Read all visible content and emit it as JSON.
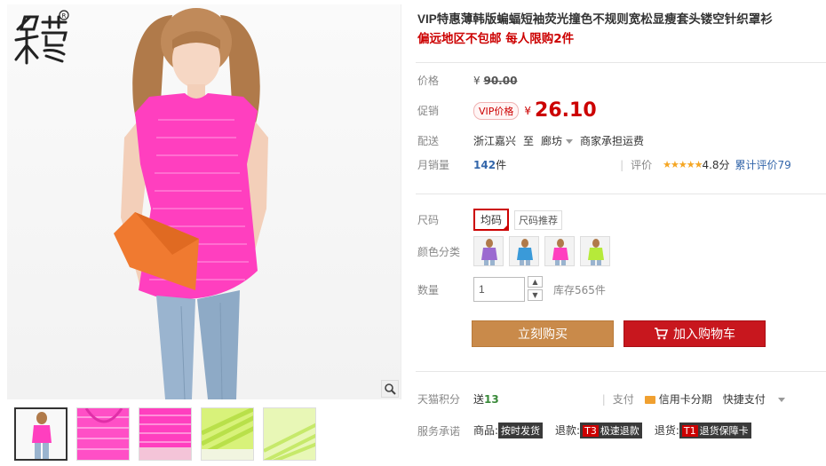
{
  "gallery": {
    "logo_text": "木莹",
    "thumbnails": [
      {
        "name": "thumb-model"
      },
      {
        "name": "thumb-pink-1"
      },
      {
        "name": "thumb-pink-2"
      },
      {
        "name": "thumb-green-1"
      },
      {
        "name": "thumb-green-2"
      }
    ]
  },
  "product": {
    "title": "VIP特惠薄韩版蝙蝠短袖荧光撞色不规则宽松显瘦套头镂空针织罩衫",
    "subtitle": "偏远地区不包邮 每人限购2件"
  },
  "price": {
    "label": "价格",
    "currency": "¥",
    "value": "90.00"
  },
  "promo": {
    "label": "促销",
    "tag": "VIP价格",
    "currency": "¥",
    "value": "26.10"
  },
  "shipping": {
    "label": "配送",
    "from": "浙江嘉兴",
    "to_word": "至",
    "to": "廊坊",
    "fee": "商家承担运费"
  },
  "sales": {
    "label": "月销量",
    "count": "142",
    "unit": "件",
    "rating_label": "评价",
    "stars": "★★★★★",
    "score": "4.8分",
    "review_link": "累计评价79"
  },
  "size": {
    "label": "尺码",
    "option": "均码",
    "recommend": "尺码推荐"
  },
  "colors": {
    "label": "颜色分类",
    "swatches": [
      "purple",
      "blue",
      "pink",
      "green"
    ]
  },
  "quantity": {
    "label": "数量",
    "value": "1",
    "stock": "库存565件"
  },
  "buttons": {
    "buy": "立刻购买",
    "cart": "加入购物车"
  },
  "points": {
    "label": "天猫积分",
    "value_prefix": "送",
    "value": "13",
    "pay_label": "支付",
    "card": "信用卡分期",
    "quick": "快捷支付"
  },
  "service": {
    "label": "服务承诺",
    "item1_prefix": "商品:",
    "item1_tag": "按时发货",
    "item2_prefix": "退款:",
    "item2_code": "T3",
    "item2_tag": "极速退款",
    "item3_prefix": "退货:",
    "item3_code": "T1",
    "item3_tag": "退货保障卡"
  },
  "colors_theme": {
    "price_red": "#cc0000",
    "buy_orange": "#c98a4a",
    "cart_red": "#c8171e",
    "link_blue": "#3366aa"
  }
}
